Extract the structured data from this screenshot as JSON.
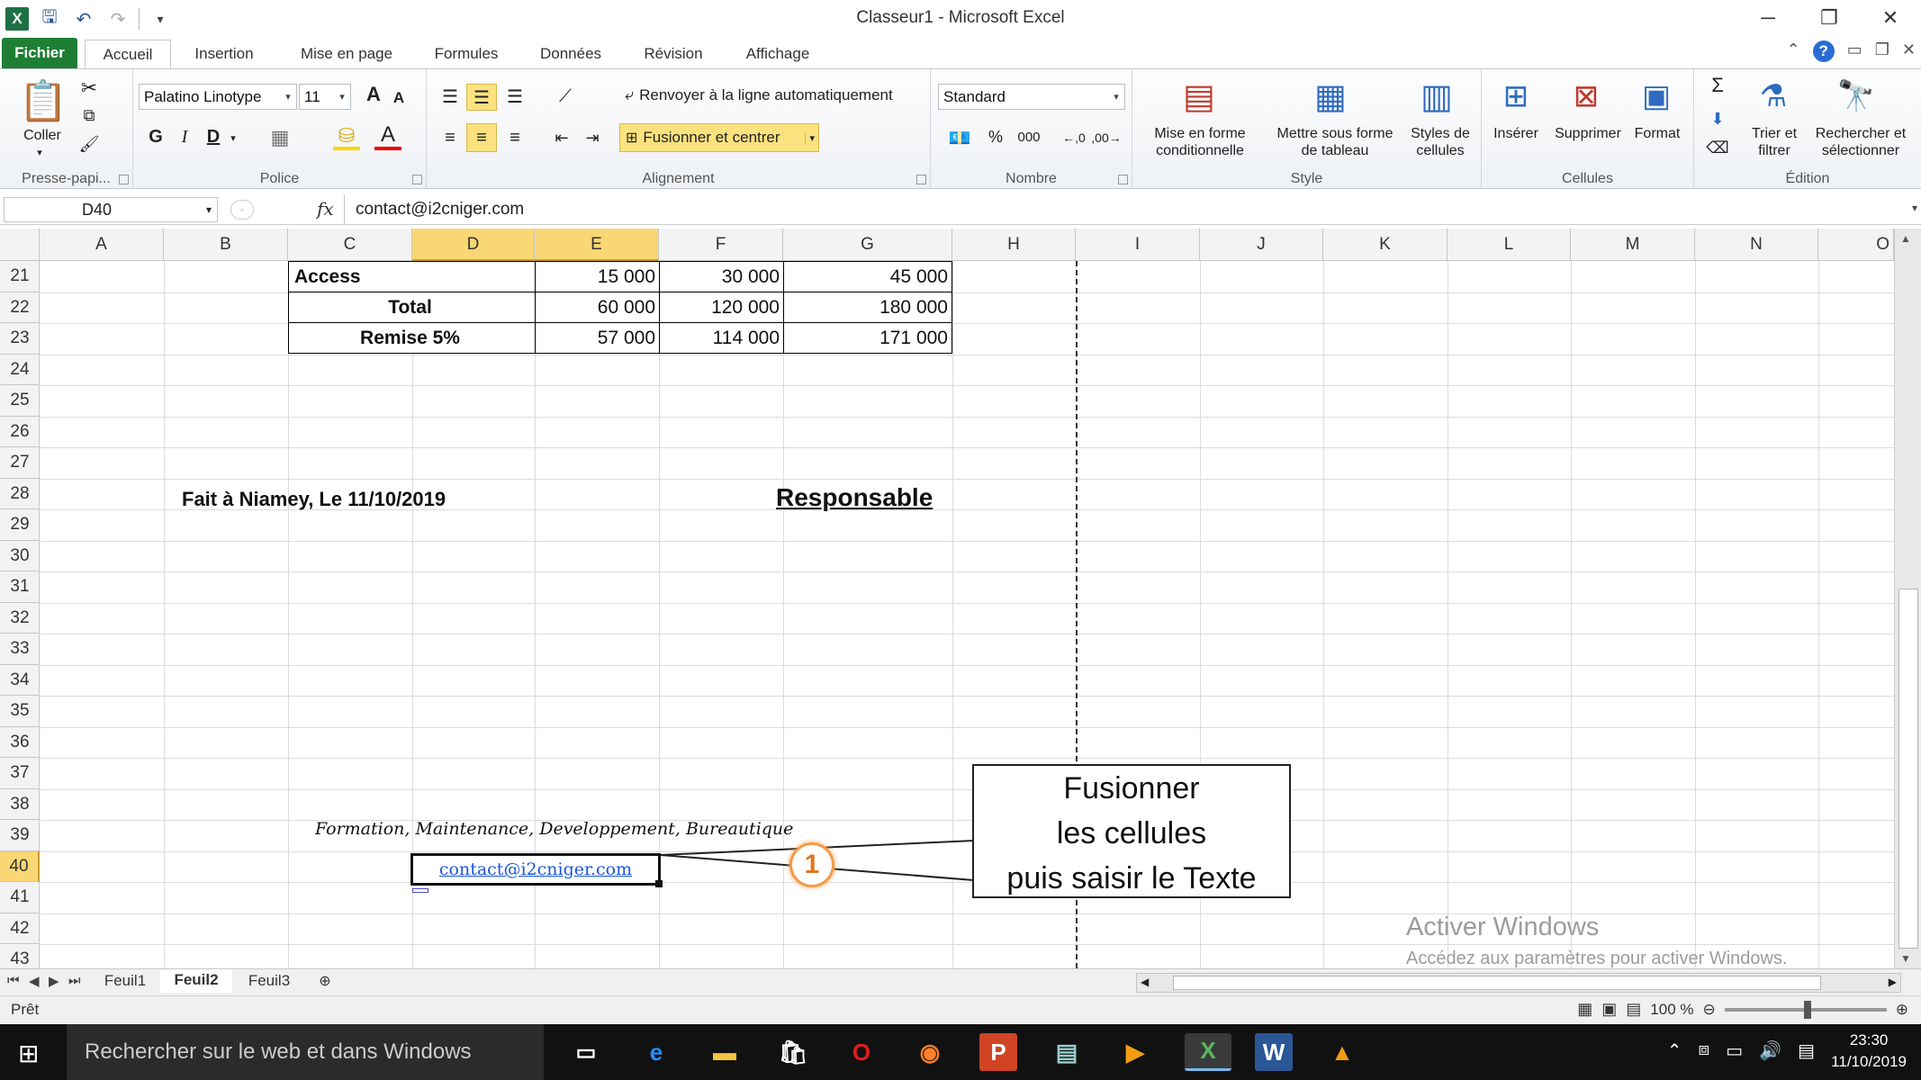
{
  "window": {
    "title": "Classeur1  -  Microsoft Excel",
    "app_icon": "X",
    "minimize": "─",
    "restore": "❐",
    "close": "✕"
  },
  "tabs": [
    "Fichier",
    "Accueil",
    "Insertion",
    "Mise en page",
    "Formules",
    "Données",
    "Révision",
    "Affichage"
  ],
  "ribbon": {
    "clipboard": {
      "paste_label": "Coller",
      "group_label": "Presse-papi..."
    },
    "font": {
      "font_name": "Palatino Linotype",
      "font_size": "11",
      "bold": "G",
      "italic": "I",
      "underline": "D",
      "grow": "A",
      "shrink": "A",
      "group_label": "Police"
    },
    "alignment": {
      "wrap_label": "Renvoyer à la ligne automatiquement",
      "merge_label": "Fusionner et centrer",
      "group_label": "Alignement"
    },
    "number": {
      "format": "Standard",
      "percent": "%",
      "thousands": "000",
      "group_label": "Nombre"
    },
    "style": {
      "cond_format": "Mise en forme conditionnelle",
      "table_format": "Mettre sous forme de tableau",
      "cell_styles": "Styles de cellules",
      "group_label": "Style"
    },
    "cells": {
      "insert": "Insérer",
      "delete": "Supprimer",
      "format": "Format",
      "group_label": "Cellules"
    },
    "editing": {
      "sum": "Σ",
      "sort_filter": "Trier et filtrer",
      "find_select": "Rechercher et sélectionner",
      "group_label": "Édition"
    }
  },
  "formula_bar": {
    "name_box": "D40",
    "fx": "fx",
    "content": "contact@i2cniger.com"
  },
  "grid": {
    "columns": [
      "A",
      "B",
      "C",
      "D",
      "E",
      "F",
      "G",
      "H",
      "I",
      "J",
      "K",
      "L",
      "M",
      "N",
      "O"
    ],
    "rows": [
      "21",
      "22",
      "23",
      "24",
      "25",
      "26",
      "27",
      "28",
      "29",
      "30",
      "31",
      "32",
      "33",
      "34",
      "35",
      "36",
      "37",
      "38",
      "39",
      "40",
      "41",
      "42",
      "43"
    ],
    "table": [
      {
        "label": "Access",
        "e": "15 000",
        "f": "30 000",
        "g": "45 000"
      },
      {
        "label": "Total",
        "e": "60 000",
        "f": "120 000",
        "g": "180 000"
      },
      {
        "label": "Remise 5%",
        "e": "57 000",
        "f": "114 000",
        "g": "171 000"
      }
    ],
    "place_date": "Fait à Niamey, Le 11/10/2019",
    "responsable": "Responsable",
    "tagline": "Formation, Maintenance, Developpement, Bureautique",
    "email": "contact@i2cniger.com"
  },
  "callout": {
    "line1": "Fusionner",
    "line2": "les cellules",
    "line3": "puis saisir le Texte",
    "badge": "1"
  },
  "watermark": {
    "title": "Activer Windows",
    "subtitle": "Accédez aux paramètres pour activer Windows."
  },
  "sheets": [
    "Feuil1",
    "Feuil2",
    "Feuil3"
  ],
  "status": {
    "ready": "Prêt",
    "zoom": "100 %"
  },
  "taskbar": {
    "search_placeholder": "Rechercher sur le web et dans Windows",
    "time": "23:30",
    "date": "11/10/2019"
  },
  "colors": {
    "file_tab": "#1e7e34",
    "selection": "#f8d774",
    "accent_badge": "#f39c4a",
    "hyperlink": "#1a56db"
  }
}
